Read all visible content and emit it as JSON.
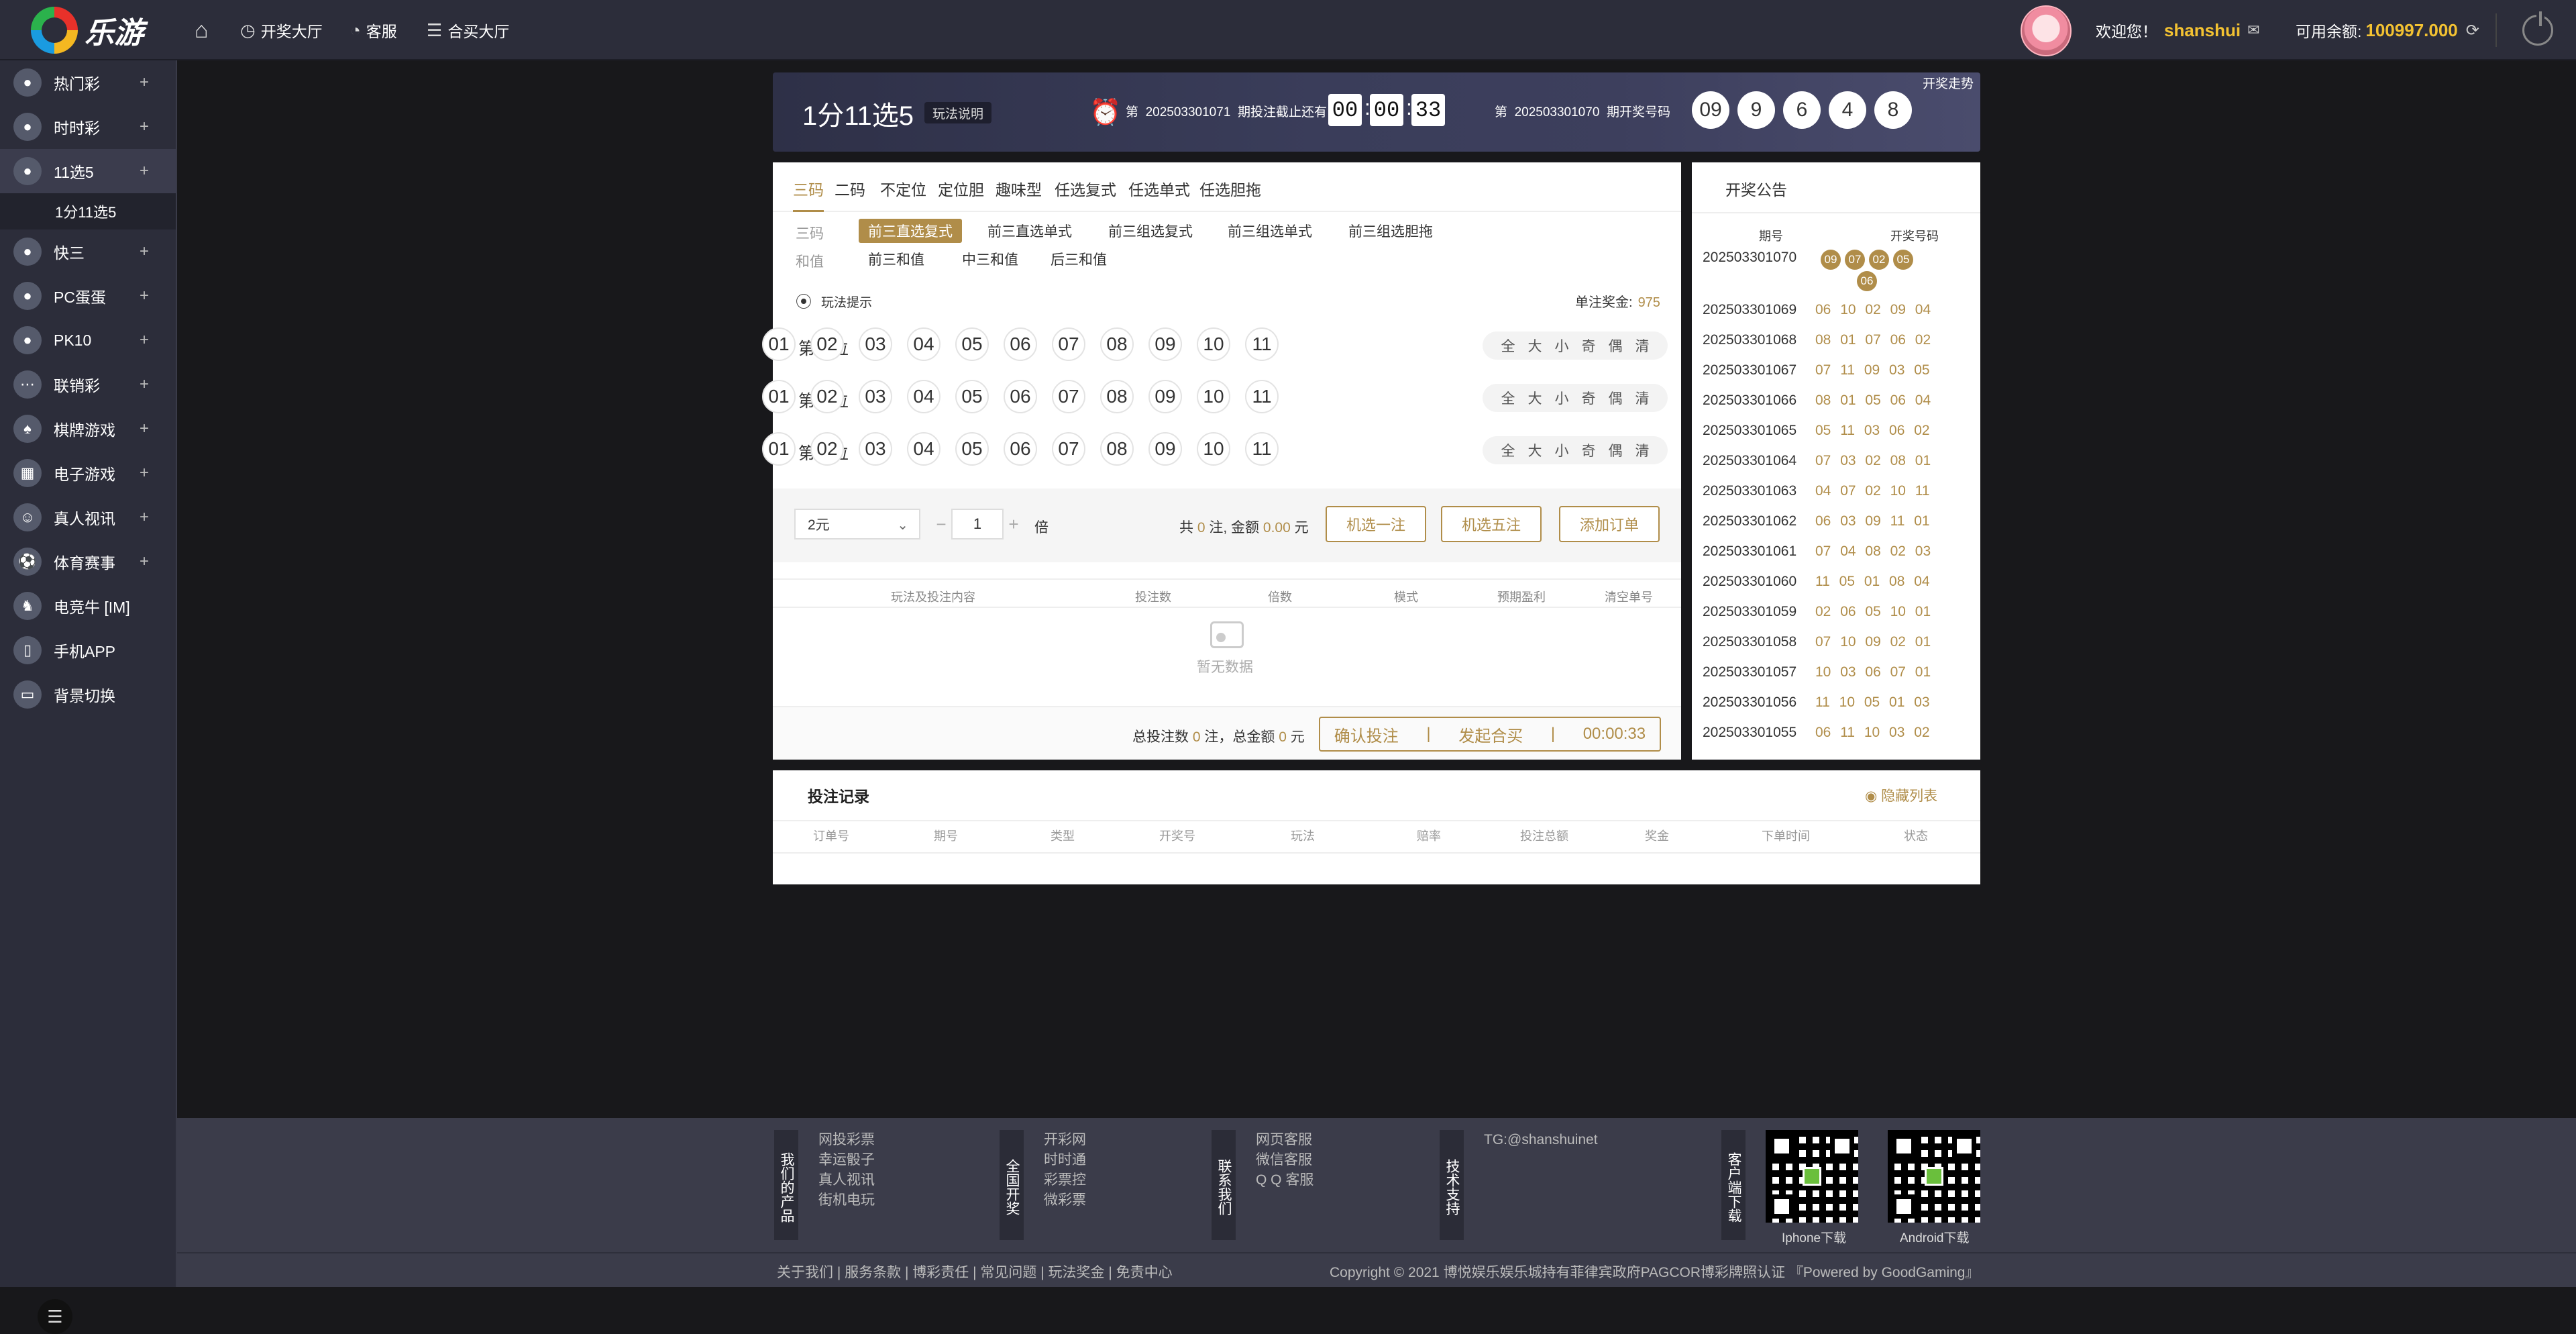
{
  "topbar": {
    "logo_text": "乐游",
    "nav": [
      {
        "label": "",
        "icon": "home-icon"
      },
      {
        "label": "开奖大厅",
        "icon": "clock-icon"
      },
      {
        "label": "客服",
        "icon": "headset-icon"
      },
      {
        "label": "合买大厅",
        "icon": "list-icon"
      }
    ],
    "welcome": "欢迎您！",
    "username": "shanshui",
    "balance_label": "可用余额:",
    "balance": "100997.000"
  },
  "sidebar": {
    "items": [
      {
        "label": "热门彩",
        "icon": "fire-icon"
      },
      {
        "label": "时时彩",
        "icon": "ssc-icon"
      },
      {
        "label": "11选5",
        "icon": "11x5-icon"
      },
      {
        "label": "快三",
        "icon": "dice-icon"
      },
      {
        "label": "PC蛋蛋",
        "icon": "pc-egg-icon"
      },
      {
        "label": "PK10",
        "icon": "pk10-icon"
      },
      {
        "label": "联销彩",
        "icon": "dots-icon"
      },
      {
        "label": "棋牌游戏",
        "icon": "cards-icon"
      },
      {
        "label": "电子游戏",
        "icon": "slot-icon"
      },
      {
        "label": "真人视讯",
        "icon": "dealer-icon"
      },
      {
        "label": "体育赛事",
        "icon": "sports-icon"
      },
      {
        "label": "电竞牛  [IM]",
        "icon": "esports-icon"
      },
      {
        "label": "手机APP",
        "icon": "phone-icon"
      },
      {
        "label": "背景切换",
        "icon": "monitor-icon"
      }
    ],
    "subitem": "1分11选5"
  },
  "banner": {
    "title": "1分11选5",
    "rule": "玩法说明",
    "cur_prefix": "第",
    "cur_issue": "202503301071",
    "cur_suffix": "期投注截止还有",
    "time": [
      "00",
      "00",
      "33"
    ],
    "last_prefix": "第",
    "last_issue": "202503301070",
    "last_suffix": "期开奖号码",
    "last_nums": [
      "09",
      "9",
      "6",
      "4",
      "8"
    ],
    "trend": "开奖走势"
  },
  "tabs": [
    "三码",
    "二码",
    "不定位",
    "定位胆",
    "趣味型",
    "任选复式",
    "任选单式",
    "任选胆拖"
  ],
  "subgroups": {
    "row1_label": "三码",
    "row1": [
      "前三直选复式",
      "前三直选单式",
      "前三组选复式",
      "前三组选单式",
      "前三组选胆拖"
    ],
    "row2_label": "和值",
    "row2": [
      "前三和值",
      "中三和值",
      "后三和值"
    ]
  },
  "hint": "玩法提示",
  "prize_label": "单注奖金:",
  "prize": "975",
  "positions": [
    {
      "label": "第一位"
    },
    {
      "label": "第二位"
    },
    {
      "label": "第三位"
    }
  ],
  "numbers": [
    "01",
    "02",
    "03",
    "04",
    "05",
    "06",
    "07",
    "08",
    "09",
    "10",
    "11"
  ],
  "quick": [
    "全",
    "大",
    "小",
    "奇",
    "偶",
    "清"
  ],
  "bet": {
    "unit": "2元",
    "multiple": "1",
    "bei": "倍",
    "total_prefix": "共",
    "total_count": "0",
    "total_mid": "注, 金额",
    "total_amount": "0.00",
    "total_suffix": "元",
    "btn_random1": "机选一注",
    "btn_random5": "机选五注",
    "btn_add": "添加订单"
  },
  "order_headers": [
    "玩法及投注内容",
    "投注数",
    "倍数",
    "模式",
    "预期盈利",
    "清空单号"
  ],
  "empty": "暂无数据",
  "footer_bar": {
    "prefix": "总投注数",
    "count": "0",
    "mid": "注，总金额",
    "amount": "0",
    "suffix": "元",
    "confirm": "确认投注",
    "sep": "|",
    "group": "发起合买",
    "timer": "00:00:33"
  },
  "results": {
    "title": "开奖公告",
    "col1": "期号",
    "col2": "开奖号码",
    "latest_issue": "202503301070",
    "latest_nums": [
      "09",
      "07",
      "02",
      "05",
      "06"
    ],
    "rows": [
      {
        "issue": "202503301069",
        "nums": "06 10 02 09 04"
      },
      {
        "issue": "202503301068",
        "nums": "08 01 07 06 02"
      },
      {
        "issue": "202503301067",
        "nums": "07 11 09 03 05"
      },
      {
        "issue": "202503301066",
        "nums": "08 01 05 06 04"
      },
      {
        "issue": "202503301065",
        "nums": "05 11 03 06 02"
      },
      {
        "issue": "202503301064",
        "nums": "07 03 02 08 01"
      },
      {
        "issue": "202503301063",
        "nums": "04 07 02 10 11"
      },
      {
        "issue": "202503301062",
        "nums": "06 03 09 11 01"
      },
      {
        "issue": "202503301061",
        "nums": "07 04 08 02 03"
      },
      {
        "issue": "202503301060",
        "nums": "11 05 01 08 04"
      },
      {
        "issue": "202503301059",
        "nums": "02 06 05 10 01"
      },
      {
        "issue": "202503301058",
        "nums": "07 10 09 02 01"
      },
      {
        "issue": "202503301057",
        "nums": "10 03 06 07 01"
      },
      {
        "issue": "202503301056",
        "nums": "11 10 05 01 03"
      },
      {
        "issue": "202503301055",
        "nums": "06 11 10 03 02"
      }
    ]
  },
  "records": {
    "title": "投注记录",
    "hide": "隐藏列表",
    "headers": [
      "订单号",
      "期号",
      "类型",
      "开奖号",
      "玩法",
      "赔率",
      "投注总额",
      "奖金",
      "下单时间",
      "状态"
    ]
  },
  "footer": {
    "col1_title": "我们的产品",
    "col1": [
      "网投彩票",
      "幸运骰子",
      "真人视讯",
      "街机电玩"
    ],
    "col2_title": "全国开奖",
    "col2": [
      "开彩网",
      "时时通",
      "彩票控",
      "微彩票"
    ],
    "col3_title": "联系我们",
    "col3": [
      "网页客服",
      "微信客服",
      "Q Q 客服"
    ],
    "col4_title": "技术支持",
    "col4": [
      "TG:@shanshuinet"
    ],
    "col5_title": "客户端下载",
    "qr1": "Iphone下载",
    "qr2": "Android下载",
    "links": "关于我们 | 服务条款 | 博彩责任 | 常见问题 | 玩法奖金 | 免责中心",
    "copyright": "Copyright © 2021 博悦娱乐娱乐城持有菲律宾政府PAGCOR博彩牌照认证 『Powered by GoodGaming』"
  }
}
